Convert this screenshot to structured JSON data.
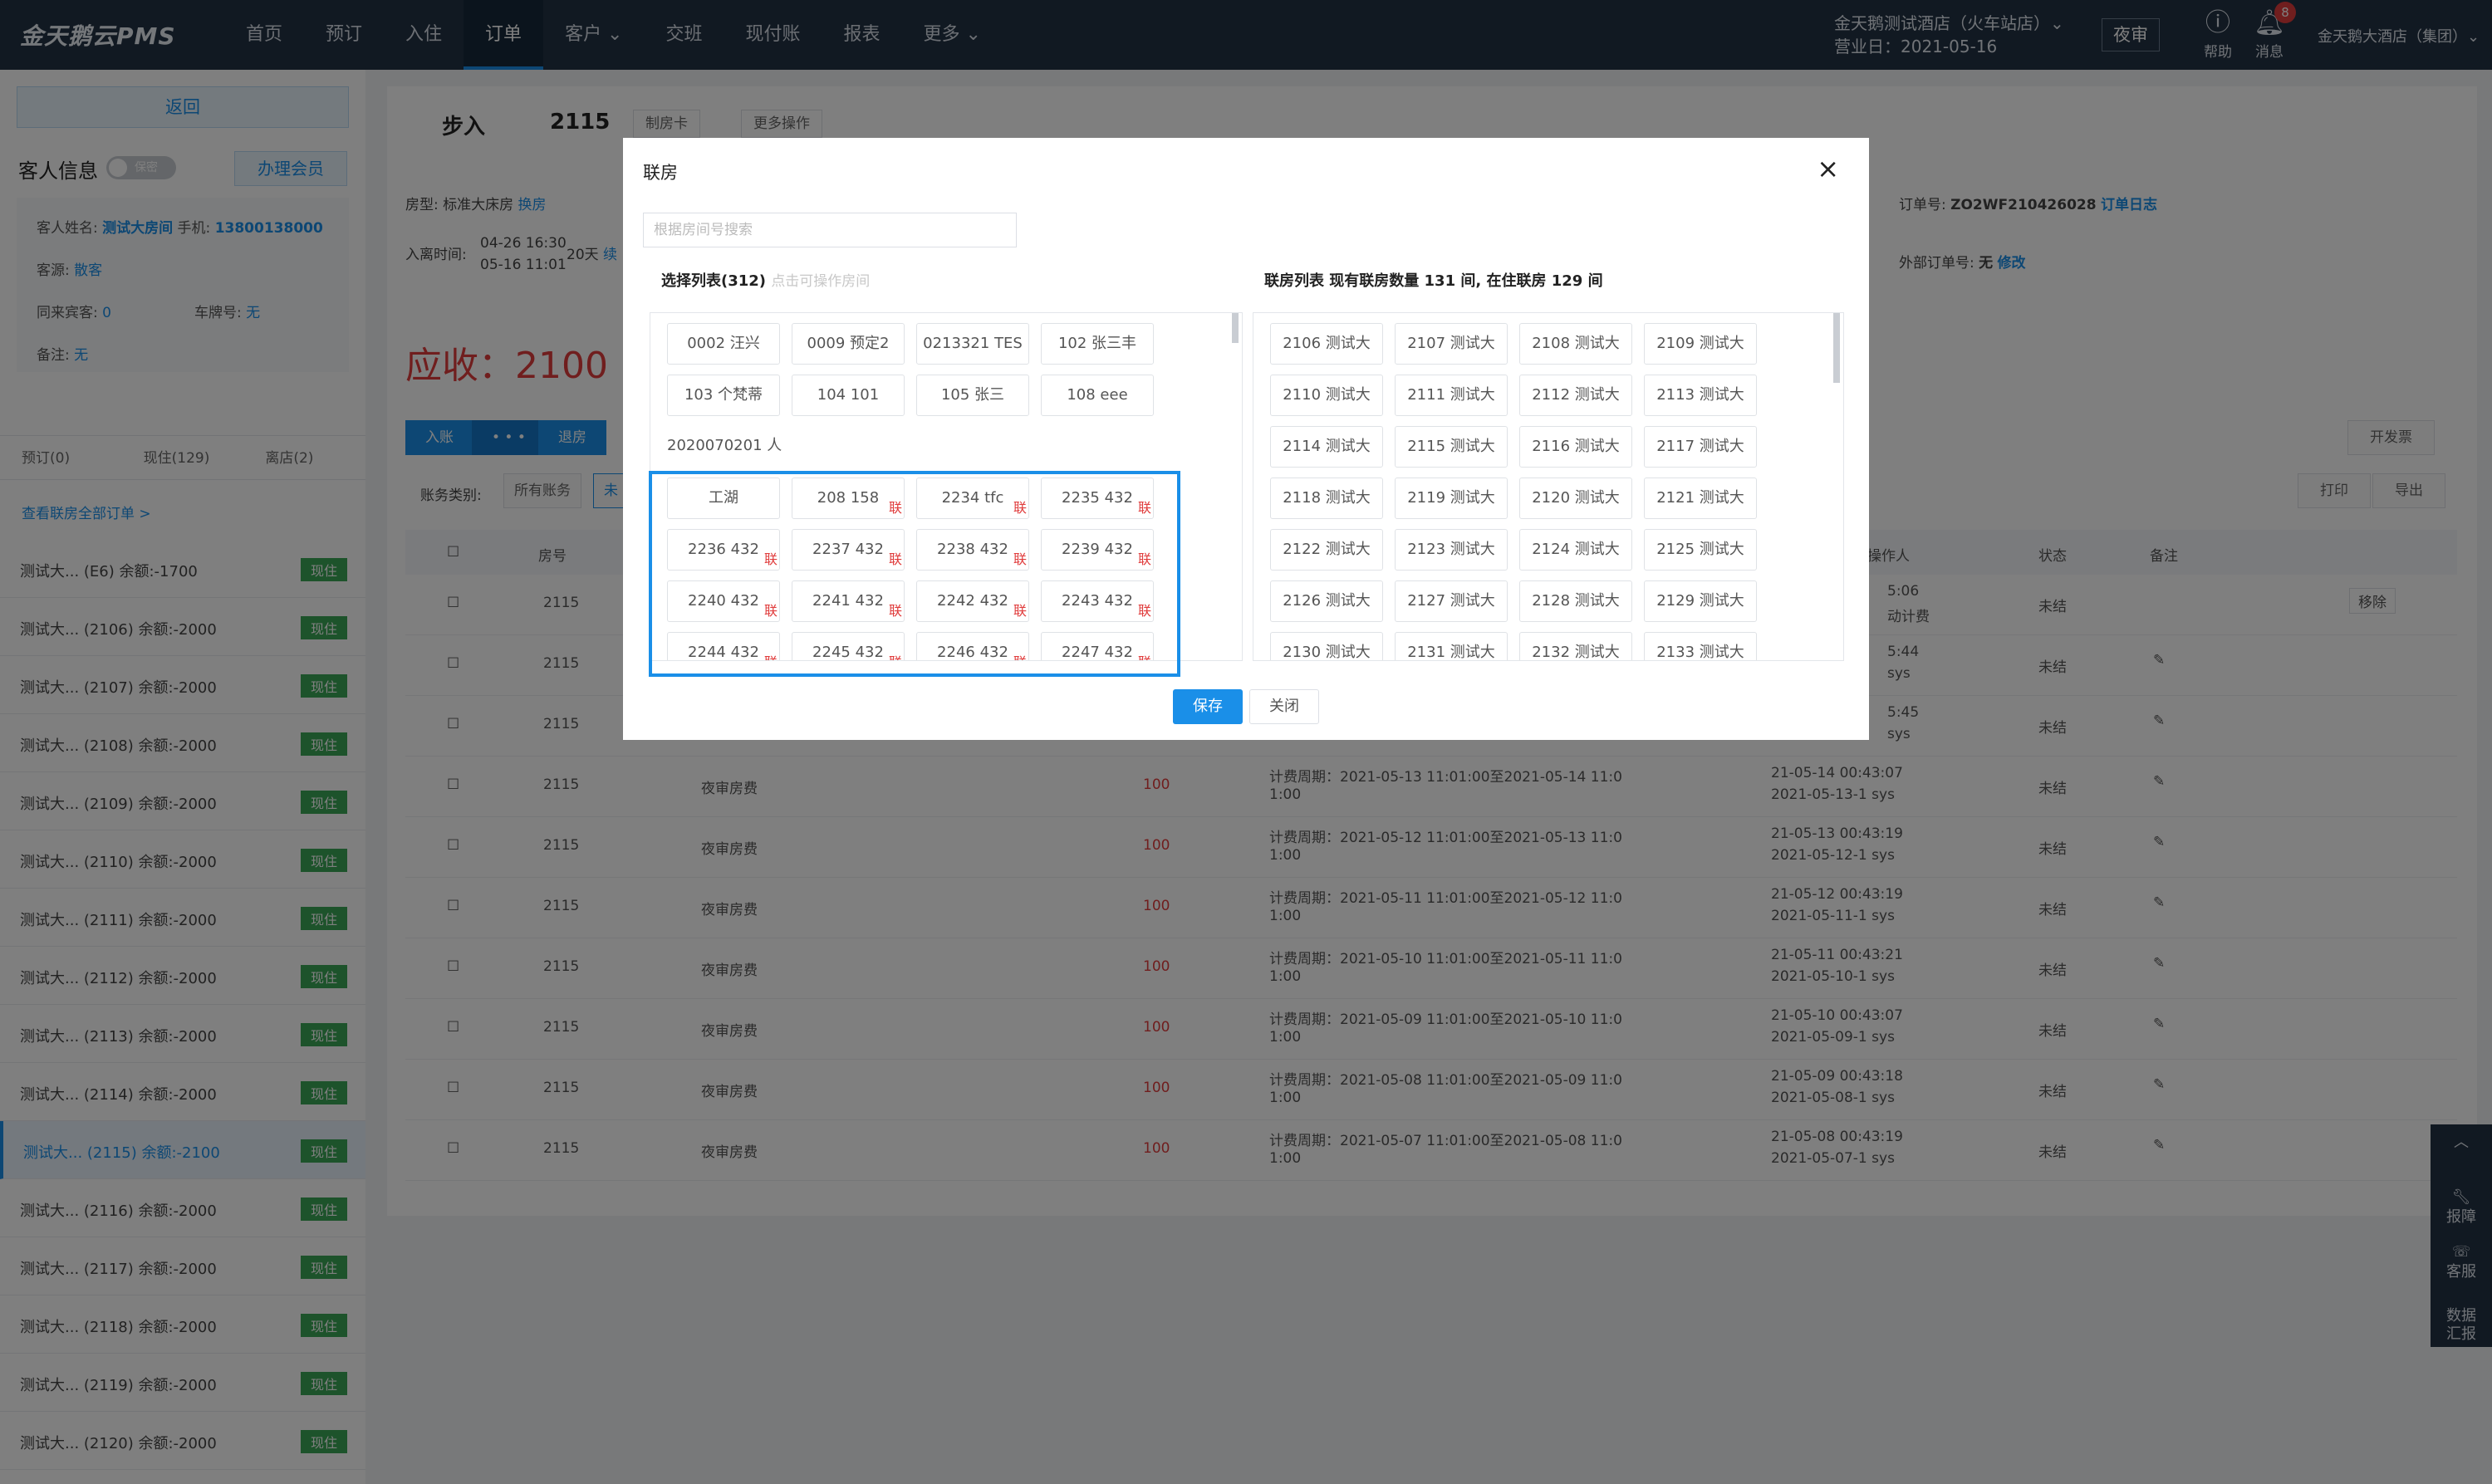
{
  "nav": {
    "logo": "金天鹅云PMS",
    "menu": [
      {
        "label": "首页"
      },
      {
        "label": "预订"
      },
      {
        "label": "入住"
      },
      {
        "label": "订单"
      },
      {
        "label": "客户 ⌄"
      },
      {
        "label": "交班"
      },
      {
        "label": "现付账"
      },
      {
        "label": "报表"
      },
      {
        "label": "更多 ⌄"
      }
    ],
    "hotel_name": "金天鹅测试酒店（火车站店）⌄",
    "business_date": "营业日：2021-05-16",
    "night_audit": "夜审",
    "help": "帮助",
    "messages": "消息",
    "message_count": "8",
    "group": "金天鹅大酒店（集团）⌄"
  },
  "sidebar": {
    "back": "返回",
    "guest_info_title": "客人信息",
    "confidential": "保密",
    "member_button": "办理会员",
    "guest_name_label": "客人姓名:",
    "guest_name": "测试大房间",
    "phone_label": "手机:",
    "phone": "13800138000",
    "source_label": "客源:",
    "source": "散客",
    "companions_label": "同来宾客:",
    "companions": "0",
    "plate_label": "车牌号:",
    "plate": "无",
    "remark_label": "备注:",
    "remark": "无",
    "tabs": [
      "预订(0)",
      "现住(129)",
      "离店(2)"
    ],
    "view_all": "查看联房全部订单 >",
    "orders": [
      {
        "text": "测试大... (E6)  余额:-1700",
        "status": "现住"
      },
      {
        "text": "测试大... (2106)  余额:-2000",
        "status": "现住"
      },
      {
        "text": "测试大... (2107)  余额:-2000",
        "status": "现住"
      },
      {
        "text": "测试大... (2108)  余额:-2000",
        "status": "现住"
      },
      {
        "text": "测试大... (2109)  余额:-2000",
        "status": "现住"
      },
      {
        "text": "测试大... (2110)  余额:-2000",
        "status": "现住"
      },
      {
        "text": "测试大... (2111)  余额:-2000",
        "status": "现住"
      },
      {
        "text": "测试大... (2112)  余额:-2000",
        "status": "现住"
      },
      {
        "text": "测试大... (2113)  余额:-2000",
        "status": "现住"
      },
      {
        "text": "测试大... (2114)  余额:-2000",
        "status": "现住"
      },
      {
        "text": "测试大... (2115)  余额:-2100",
        "status": "现住"
      },
      {
        "text": "测试大... (2116)  余额:-2000",
        "status": "现住"
      },
      {
        "text": "测试大... (2117)  余额:-2000",
        "status": "现住"
      },
      {
        "text": "测试大... (2118)  余额:-2000",
        "status": "现住"
      },
      {
        "text": "测试大... (2119)  余额:-2000",
        "status": "现住"
      },
      {
        "text": "测试大... (2120)  余额:-2000",
        "status": "现住"
      }
    ]
  },
  "main": {
    "checkin_type": "步入",
    "room_no": "2115",
    "make_card": "制房卡",
    "more_ops": "更多操作",
    "room_type_label": "房型:",
    "room_type": "标准大床房",
    "change_room": "换房",
    "stay_label": "入离时间:",
    "stay_in": "04-26 16:30",
    "stay_out": "05-16 11:01",
    "nights": "20天",
    "stay_suffix": "续",
    "order_no_label": "订单号:",
    "order_no": "ZO2WF210426028",
    "order_log": "订单日志",
    "ext_order_label": "外部订单号:",
    "ext_order": "无",
    "ext_edit": "修改",
    "due": "应收：2100",
    "btn_entry": "入账",
    "btn_dots": "• • •",
    "btn_refund": "退房",
    "btn_invoice": "开发票",
    "btn_print": "打印",
    "btn_export": "导出",
    "acct_type_label": "账务类别:",
    "acct_all": "所有账务",
    "acct_unsettled": "未",
    "headers": {
      "room": "房号",
      "operator": "操作人",
      "state": "状态",
      "remark": "备注"
    },
    "rows": [
      {
        "room": "2115",
        "item": "",
        "amount": "",
        "period1": "",
        "period2": "",
        "op1": "5:06",
        "op2": "动计费",
        "state": "未结",
        "extra": "移除"
      },
      {
        "room": "2115",
        "item": "",
        "amount": "",
        "period1": "",
        "period2": "",
        "op1": "5:44",
        "op2": "sys",
        "state": "未结",
        "extra": "✎"
      },
      {
        "room": "2115",
        "item": "",
        "amount": "",
        "period1": "",
        "period2": "",
        "op1": "5:45",
        "op2": "sys",
        "state": "未结",
        "extra": "✎"
      },
      {
        "room": "2115",
        "item": "夜审房费",
        "amount": "100",
        "period1": "计费周期：2021-05-13 11:01:00至2021-05-14 11:0",
        "period2": "1:00",
        "op1": "21-05-14 00:43:07",
        "op2": "2021-05-13-1 sys",
        "state": "未结",
        "extra": "✎"
      },
      {
        "room": "2115",
        "item": "夜审房费",
        "amount": "100",
        "period1": "计费周期：2021-05-12 11:01:00至2021-05-13 11:0",
        "period2": "1:00",
        "op1": "21-05-13 00:43:19",
        "op2": "2021-05-12-1 sys",
        "state": "未结",
        "extra": "✎"
      },
      {
        "room": "2115",
        "item": "夜审房费",
        "amount": "100",
        "period1": "计费周期：2021-05-11 11:01:00至2021-05-12 11:0",
        "period2": "1:00",
        "op1": "21-05-12 00:43:19",
        "op2": "2021-05-11-1 sys",
        "state": "未结",
        "extra": "✎"
      },
      {
        "room": "2115",
        "item": "夜审房费",
        "amount": "100",
        "period1": "计费周期：2021-05-10 11:01:00至2021-05-11 11:0",
        "period2": "1:00",
        "op1": "21-05-11 00:43:21",
        "op2": "2021-05-10-1 sys",
        "state": "未结",
        "extra": "✎"
      },
      {
        "room": "2115",
        "item": "夜审房费",
        "amount": "100",
        "period1": "计费周期：2021-05-09 11:01:00至2021-05-10 11:0",
        "period2": "1:00",
        "op1": "21-05-10 00:43:07",
        "op2": "2021-05-09-1 sys",
        "state": "未结",
        "extra": "✎"
      },
      {
        "room": "2115",
        "item": "夜审房费",
        "amount": "100",
        "period1": "计费周期：2021-05-08 11:01:00至2021-05-09 11:0",
        "period2": "1:00",
        "op1": "21-05-09 00:43:18",
        "op2": "2021-05-08-1 sys",
        "state": "未结",
        "extra": "✎"
      },
      {
        "room": "2115",
        "item": "夜审房费",
        "amount": "100",
        "period1": "计费周期：2021-05-07 11:01:00至2021-05-08 11:0",
        "period2": "1:00",
        "op1": "21-05-08 00:43:19",
        "op2": "2021-05-07-1 sys",
        "state": "未结",
        "extra": "✎"
      }
    ]
  },
  "modal": {
    "title": "联房",
    "close": "×",
    "search_placeholder": "根据房间号搜索",
    "left_title": "选择列表(312)",
    "left_hint": "点击可操作房间",
    "right_title": "联房列表  现有联房数量 131 间, 在住联房 129 间",
    "link_mark": "联",
    "left_items": [
      {
        "label": "0002  汪兴",
        "linked": false
      },
      {
        "label": "0009  预定2",
        "linked": false
      },
      {
        "label": "0213321  TES",
        "linked": false
      },
      {
        "label": "102  张三丰",
        "linked": false
      },
      {
        "label": "103  个梵蒂",
        "linked": false
      },
      {
        "label": "104  101",
        "linked": false
      },
      {
        "label": "105  张三",
        "linked": false
      },
      {
        "label": "108  eee",
        "linked": false
      },
      {
        "label": "2020070201  人",
        "linked": false
      },
      {
        "label": "工湖",
        "linked": false
      },
      {
        "label": "208  158",
        "linked": true
      },
      {
        "label": "2234  tfc",
        "linked": true
      },
      {
        "label": "2235  432",
        "linked": true
      },
      {
        "label": "2236  432",
        "linked": true
      },
      {
        "label": "2237  432",
        "linked": true
      },
      {
        "label": "2238  432",
        "linked": true
      },
      {
        "label": "2239  432",
        "linked": true
      },
      {
        "label": "2240  432",
        "linked": true
      },
      {
        "label": "2241  432",
        "linked": true
      },
      {
        "label": "2242  432",
        "linked": true
      },
      {
        "label": "2243  432",
        "linked": true
      },
      {
        "label": "2244  432",
        "linked": true
      },
      {
        "label": "2245  432",
        "linked": true
      },
      {
        "label": "2246  432",
        "linked": true
      },
      {
        "label": "2247  432",
        "linked": true
      }
    ],
    "right_items": [
      "2106  测试大",
      "2107  测试大",
      "2108  测试大",
      "2109  测试大",
      "2110  测试大",
      "2111  测试大",
      "2112  测试大",
      "2113  测试大",
      "2114  测试大",
      "2115  测试大",
      "2116  测试大",
      "2117  测试大",
      "2118  测试大",
      "2119  测试大",
      "2120  测试大",
      "2121  测试大",
      "2122  测试大",
      "2123  测试大",
      "2124  测试大",
      "2125  测试大",
      "2126  测试大",
      "2127  测试大",
      "2128  测试大",
      "2129  测试大",
      "2130  测试大",
      "2131  测试大",
      "2132  测试大",
      "2133  测试大"
    ],
    "save": "保存",
    "cancel": "关闭"
  },
  "floatbar": {
    "top": "︿",
    "report": "报障",
    "service": "客服",
    "data": "数据汇报"
  }
}
